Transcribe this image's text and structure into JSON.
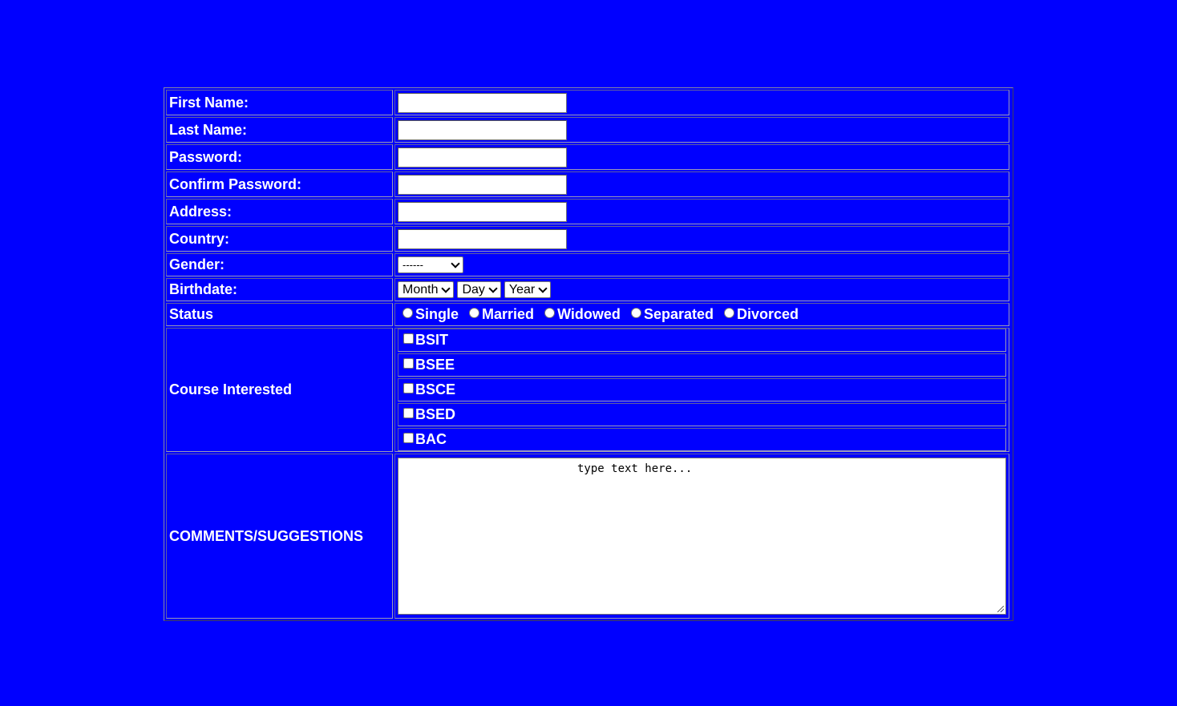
{
  "form": {
    "first_name_label": "First Name:",
    "last_name_label": "Last Name:",
    "password_label": "Password:",
    "confirm_password_label": "Confirm Password:",
    "address_label": "Address:",
    "country_label": "Country:",
    "gender_label": "Gender:",
    "gender_selected": "------",
    "birthdate_label": "Birthdate:",
    "birth_month": "Month",
    "birth_day": "Day",
    "birth_year": "Year",
    "status_label": "Status",
    "status_options": [
      "Single",
      "Married",
      "Widowed",
      "Separated",
      "Divorced"
    ],
    "course_label": "Course Interested",
    "courses": [
      "BSIT",
      "BSEE",
      "BSCE",
      "BSED",
      "BAC"
    ],
    "comments_label": "COMMENTS/SUGGESTIONS",
    "comments_value": "type text here..."
  },
  "colors": {
    "background": "#0000ff",
    "text": "#ffffff"
  }
}
